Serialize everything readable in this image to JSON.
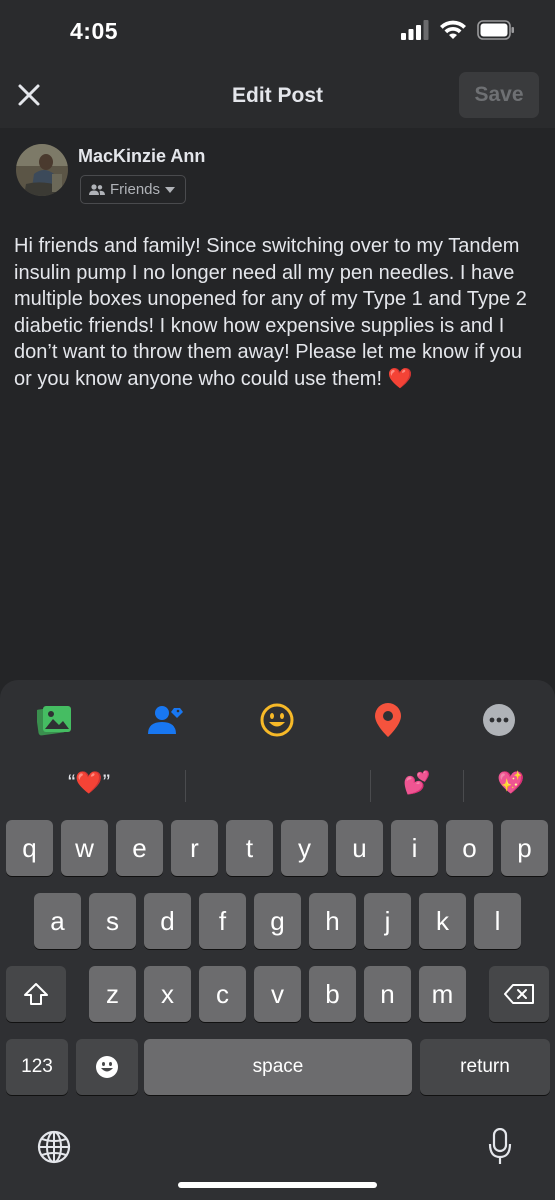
{
  "status_bar": {
    "time": "4:05"
  },
  "nav": {
    "title": "Edit Post",
    "save_label": "Save"
  },
  "author": {
    "name": "MacKinzie Ann",
    "audience": "Friends"
  },
  "post": {
    "text": "Hi friends and family! Since switching over to my Tandem insulin pump I no longer need all my pen needles. I have multiple boxes unopened for any of my Type 1 and Type 2 diabetic friends! I know how expensive supplies is and I don’t want to throw them away! Please let me know if you or you know anyone who could use them! ❤️"
  },
  "composer_tray": {
    "icons": [
      "photo-icon",
      "tag-people-icon",
      "feeling-emoji-icon",
      "location-pin-icon",
      "more-options-icon"
    ],
    "colors": {
      "photo": "#45bd62",
      "tag": "#1877f2",
      "feeling": "#f7b928",
      "location": "#f5533d",
      "more": "#b0b3b8"
    }
  },
  "suggestions": {
    "left": "“❤️”",
    "middle": "💕",
    "right": "💖"
  },
  "keyboard": {
    "row1": [
      "q",
      "w",
      "e",
      "r",
      "t",
      "y",
      "u",
      "i",
      "o",
      "p"
    ],
    "row2": [
      "a",
      "s",
      "d",
      "f",
      "g",
      "h",
      "j",
      "k",
      "l"
    ],
    "row3": [
      "z",
      "x",
      "c",
      "v",
      "b",
      "n",
      "m"
    ],
    "numbers_label": "123",
    "space_label": "space",
    "return_label": "return"
  }
}
